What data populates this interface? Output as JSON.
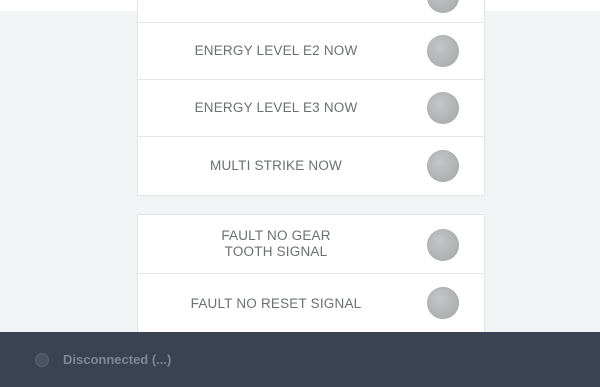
{
  "panels": [
    {
      "rows": [
        {
          "label": "",
          "indicator": "off"
        },
        {
          "label": "ENERGY LEVEL E2 NOW",
          "indicator": "off"
        },
        {
          "label": "ENERGY LEVEL E3 NOW",
          "indicator": "off"
        },
        {
          "label": "MULTI STRIKE NOW",
          "indicator": "off"
        }
      ]
    },
    {
      "rows": [
        {
          "label": "FAULT NO GEAR TOOTH SIGNAL",
          "indicator": "off"
        },
        {
          "label": "FAULT NO RESET SIGNAL",
          "indicator": "off"
        }
      ]
    }
  ],
  "status": {
    "text": "Disconnected (...)",
    "icon": "connection-status-icon",
    "bar_color": "#3a4352",
    "indicator_off_color": "#b2b4b6"
  }
}
